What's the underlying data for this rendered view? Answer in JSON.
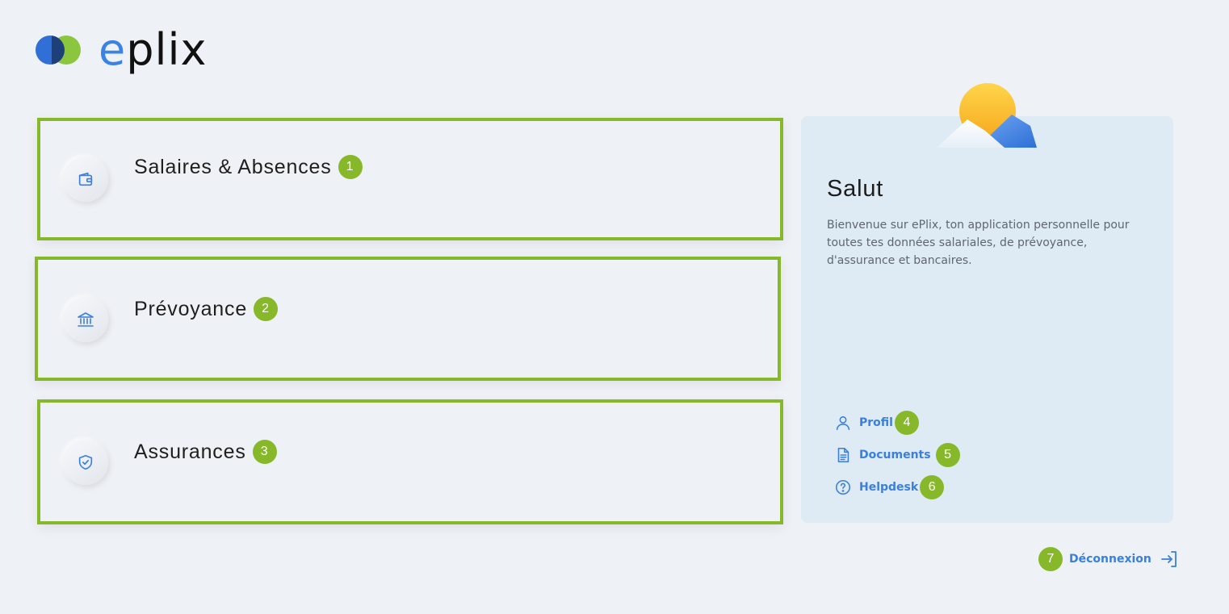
{
  "brand": {
    "logo_text_e": "e",
    "logo_text_rest": "plix",
    "colors": {
      "blue": "#2f6fd6",
      "green": "#8cc63f",
      "accent_link": "#3a7fdd",
      "highlight": "#86b82a"
    }
  },
  "cards": [
    {
      "title": "Salaires & Absences",
      "badge": "1",
      "icon": "wallet-icon"
    },
    {
      "title": "Prévoyance",
      "badge": "2",
      "icon": "bank-icon"
    },
    {
      "title": "Assurances",
      "badge": "3",
      "icon": "shield-check-icon"
    }
  ],
  "side": {
    "greeting": "Salut",
    "description": "Bienvenue sur ePlix, ton application personnelle pour toutes tes données salariales, de prévoyance, d'assurance et bancaires.",
    "illustration": "sun-mountain-illustration",
    "links": [
      {
        "label": "Profil",
        "badge": "4",
        "icon": "user-icon"
      },
      {
        "label": "Documents",
        "badge": "5",
        "icon": "document-icon"
      },
      {
        "label": "Helpdesk",
        "badge": "6",
        "icon": "help-circle-icon"
      }
    ]
  },
  "logout": {
    "label": "Déconnexion",
    "badge": "7",
    "icon": "logout-icon"
  }
}
